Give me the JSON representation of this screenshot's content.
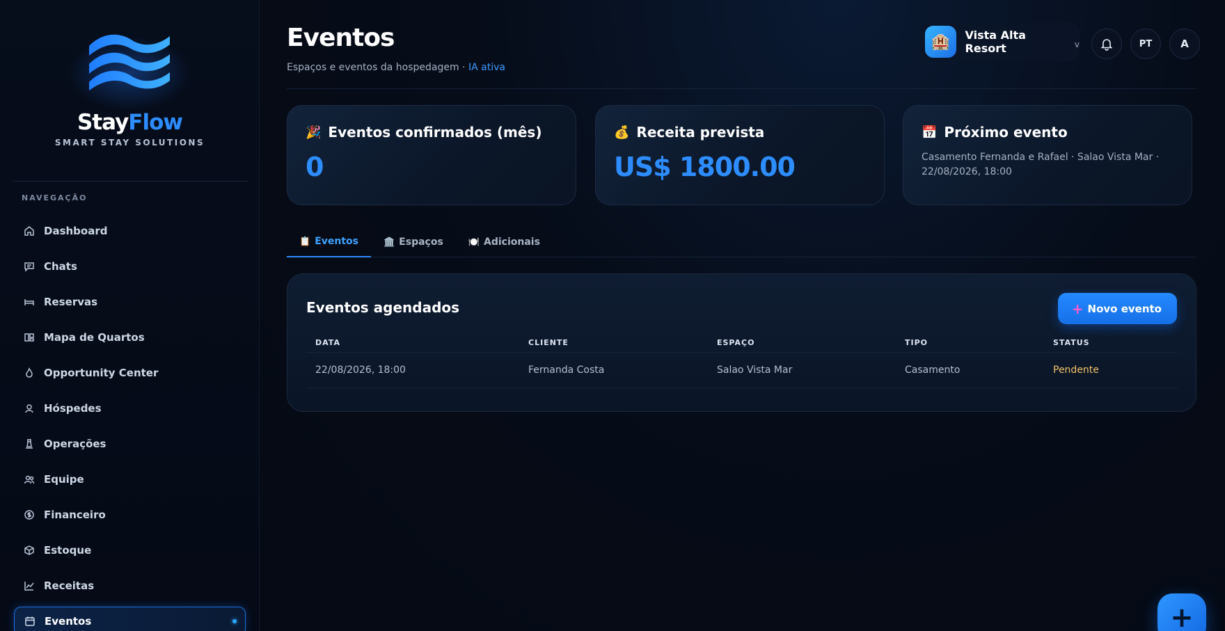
{
  "brand": {
    "name_part1": "Stay",
    "name_part2": "Flow",
    "tagline": "SMART STAY SOLUTIONS"
  },
  "sidebar": {
    "heading": "NAVEGAÇÃO",
    "items": [
      {
        "label": "Dashboard",
        "icon": "home-icon"
      },
      {
        "label": "Chats",
        "icon": "chat-icon"
      },
      {
        "label": "Reservas",
        "icon": "bed-icon"
      },
      {
        "label": "Mapa de Quartos",
        "icon": "layout-icon"
      },
      {
        "label": "Opportunity Center",
        "icon": "flame-icon"
      },
      {
        "label": "Hóspedes",
        "icon": "user-icon"
      },
      {
        "label": "Operações",
        "icon": "chess-icon"
      },
      {
        "label": "Equipe",
        "icon": "users-icon"
      },
      {
        "label": "Financeiro",
        "icon": "dollar-icon"
      },
      {
        "label": "Estoque",
        "icon": "box-icon"
      },
      {
        "label": "Receitas",
        "icon": "chart-icon"
      },
      {
        "label": "Eventos",
        "icon": "calendar-icon",
        "active": true
      }
    ]
  },
  "header": {
    "title": "Eventos",
    "subtitle": "Espaços e eventos da hospedagem · ",
    "ai_status": "IA ativa",
    "hotel_name": "Vista Alta Resort",
    "hotel_icon": "🏨",
    "lang": "PT",
    "user_initial": "A"
  },
  "cards": {
    "confirmed": {
      "emoji": "🎉",
      "title": "Eventos confirmados (mês)",
      "value": "0"
    },
    "revenue": {
      "emoji": "💰",
      "title": "Receita prevista",
      "value": "US$ 1800.00"
    },
    "next": {
      "emoji": "📅",
      "title": "Próximo evento",
      "text": "Casamento Fernanda e Rafael · Salao Vista Mar · 22/08/2026, 18:00"
    }
  },
  "tabs": [
    {
      "emoji": "📋",
      "label": "Eventos",
      "active": true
    },
    {
      "emoji": "🏛️",
      "label": "Espaços"
    },
    {
      "emoji": "🍽️",
      "label": "Adicionais"
    }
  ],
  "table": {
    "title": "Eventos agendados",
    "new_button": "Novo evento",
    "columns": [
      "DATA",
      "CLIENTE",
      "ESPAÇO",
      "TIPO",
      "STATUS"
    ],
    "rows": [
      {
        "data": "22/08/2026, 18:00",
        "cliente": "Fernanda Costa",
        "espaco": "Salao Vista Mar",
        "tipo": "Casamento",
        "status": "Pendente"
      }
    ]
  },
  "fab": {
    "label": "+"
  },
  "colors": {
    "accent": "#2d8cff",
    "status_pending": "#f3c266",
    "background": "#050a14"
  }
}
